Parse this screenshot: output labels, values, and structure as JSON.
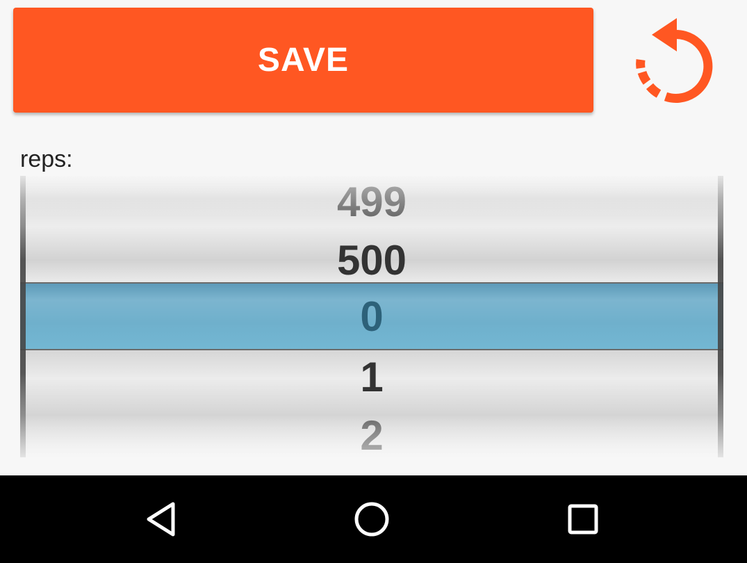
{
  "toolbar": {
    "save_label": "SAVE",
    "reset_icon": "reset-icon"
  },
  "form": {
    "reps_label": "reps:"
  },
  "picker": {
    "values": [
      "499",
      "500",
      "0",
      "1",
      "2"
    ],
    "selected_value": "0"
  },
  "navigation": {
    "back_icon": "back-icon",
    "home_icon": "home-icon",
    "recents_icon": "recents-icon"
  },
  "colors": {
    "accent": "#ff5722",
    "picker_selection": "#6fb0cc",
    "nav_bar": "#000000"
  }
}
